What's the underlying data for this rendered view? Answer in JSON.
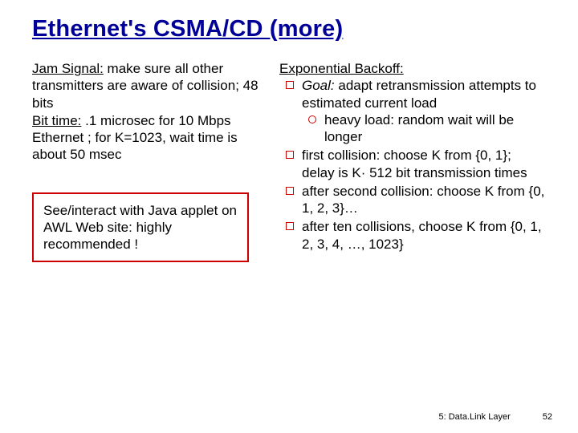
{
  "title": "Ethernet's CSMA/CD (more)",
  "left": {
    "jam": {
      "term": "Jam Signal:",
      "text": " make sure all other transmitters are aware of collision; 48 bits"
    },
    "bit": {
      "term": "Bit time:",
      "text": " .1 microsec for 10 Mbps Ethernet ; for K=1023, wait time is about 50 msec"
    },
    "callout": "See/interact with Java applet on AWL Web site: highly recommended !"
  },
  "right": {
    "heading": "Exponential Backoff:",
    "b1a": "Goal:",
    "b1b": " adapt retransmission attempts to estimated current load",
    "b1sub": "heavy load: random wait will be longer",
    "b2": "first collision: choose K from {0, 1}; delay is K· 512 bit transmission times",
    "b3": "after second collision: choose K from {0, 1, 2, 3}…",
    "b4": "after ten collisions, choose K from {0, 1, 2, 3, 4, …, 1023}"
  },
  "footer": {
    "section": "5: Data.Link Layer",
    "page": "52"
  }
}
